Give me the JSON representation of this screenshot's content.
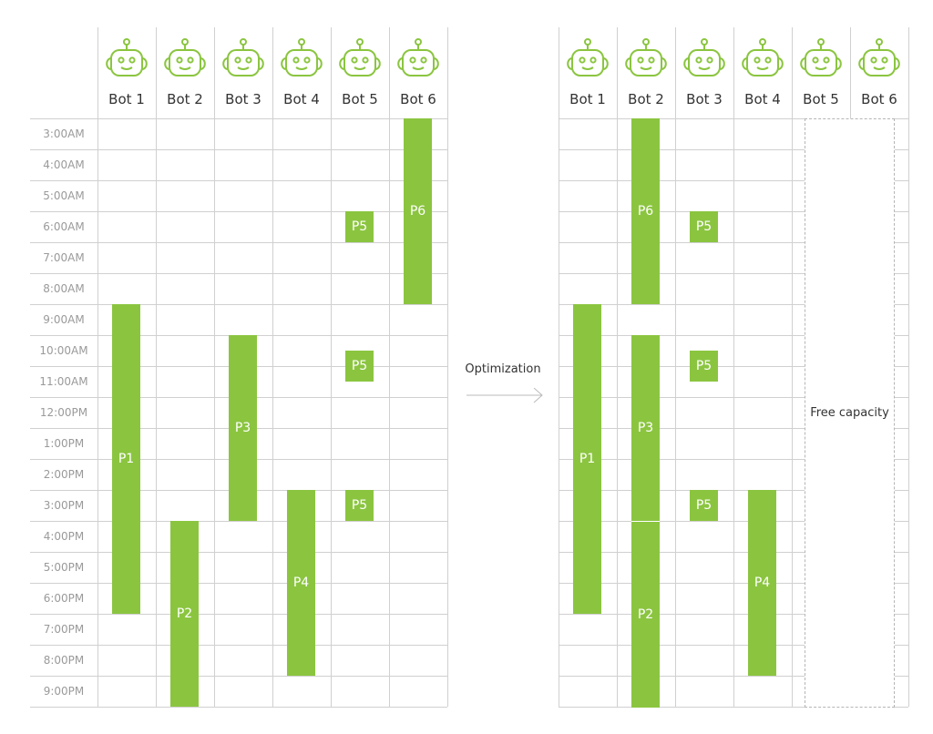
{
  "colors": {
    "accent": "#8bc540",
    "grid": "#d0d0d0",
    "time_text": "#9a9a9a"
  },
  "bots": [
    "Bot 1",
    "Bot 2",
    "Bot 3",
    "Bot 4",
    "Bot 5",
    "Bot 6"
  ],
  "bot_icon": "robot-icon",
  "times": [
    "3:00AM",
    "4:00AM",
    "5:00AM",
    "6:00AM",
    "7:00AM",
    "8:00AM",
    "9:00AM",
    "10:00AM",
    "11:00AM",
    "12:00PM",
    "1:00PM",
    "2:00PM",
    "3:00PM",
    "4:00PM",
    "5:00PM",
    "6:00PM",
    "7:00PM",
    "8:00PM",
    "9:00PM"
  ],
  "before": {
    "processes": [
      {
        "label": "P1",
        "bot": 1,
        "start": 9,
        "end": 19
      },
      {
        "label": "P2",
        "bot": 2,
        "start": 16,
        "end": 22
      },
      {
        "label": "P3",
        "bot": 3,
        "start": 10,
        "end": 16
      },
      {
        "label": "P4",
        "bot": 4,
        "start": 15,
        "end": 21
      },
      {
        "label": "P5",
        "bot": 5,
        "start": 6,
        "end": 7
      },
      {
        "label": "P5",
        "bot": 5,
        "start": 10.5,
        "end": 11.5
      },
      {
        "label": "P5",
        "bot": 5,
        "start": 15,
        "end": 16
      },
      {
        "label": "P6",
        "bot": 6,
        "start": 3,
        "end": 9
      }
    ]
  },
  "transition": {
    "label": "Optimization",
    "icon": "arrow-right-icon"
  },
  "after": {
    "processes": [
      {
        "label": "P1",
        "bot": 1,
        "start": 9,
        "end": 19
      },
      {
        "label": "P6",
        "bot": 2,
        "start": 3,
        "end": 9
      },
      {
        "label": "P3",
        "bot": 2,
        "start": 10,
        "end": 16
      },
      {
        "label": "P2",
        "bot": 2,
        "start": 16,
        "end": 22
      },
      {
        "label": "P5",
        "bot": 3,
        "start": 6,
        "end": 7
      },
      {
        "label": "P5",
        "bot": 3,
        "start": 10.5,
        "end": 11.5
      },
      {
        "label": "P5",
        "bot": 3,
        "start": 15,
        "end": 16
      },
      {
        "label": "P4",
        "bot": 4,
        "start": 15,
        "end": 21
      }
    ],
    "free_capacity": {
      "label": "Free capacity",
      "bots": [
        5,
        6
      ]
    }
  }
}
